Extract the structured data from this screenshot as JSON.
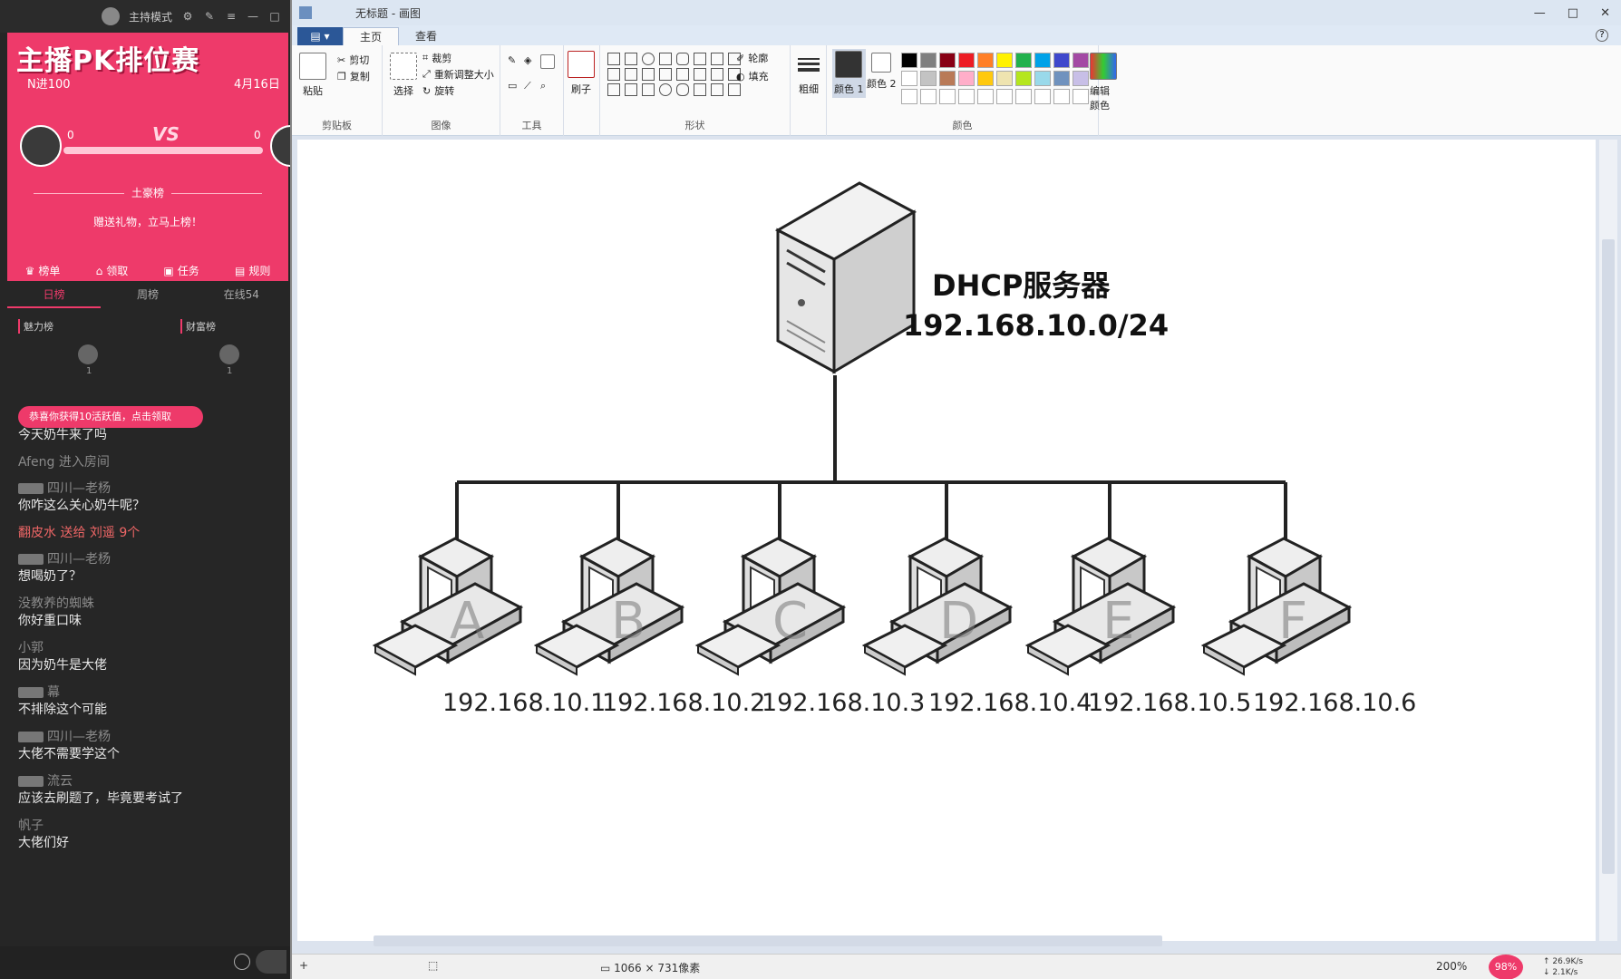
{
  "stream": {
    "mode": "主持模式",
    "pk_title": "主播PK排位赛",
    "pk_round": "N进100",
    "pk_date": "4月16日",
    "score_left": "0",
    "score_right": "0",
    "vs": "VS",
    "rich_label": "土豪榜",
    "gift_prompt": "赠送礼物，立马上榜！",
    "nav": [
      "榜单",
      "领取",
      "任务",
      "规则"
    ],
    "tabs": [
      "日榜",
      "周榜",
      "在线54"
    ],
    "sub_tabs": [
      "魅力榜",
      "财富榜"
    ],
    "rank_nums": [
      "1",
      "1"
    ],
    "claim": "恭喜你获得10活跃值，点击领取",
    "chat": [
      {
        "who": "",
        "text": "今天奶牛来了吗"
      },
      {
        "who": "Afeng 进入房间",
        "text": ""
      },
      {
        "who": "四川—老杨",
        "text": "你咋这么关心奶牛呢？",
        "badge": true
      },
      {
        "who": "翻皮水 送给 刘遥 9个",
        "text": "",
        "gift": true
      },
      {
        "who": "四川—老杨",
        "text": "想喝奶了？",
        "badge": true
      },
      {
        "who": "没教养的蜘蛛",
        "text": "你好重口味"
      },
      {
        "who": "小郭",
        "text": "因为奶牛是大佬"
      },
      {
        "who": "幕",
        "text": "不排除这个可能",
        "badge": true
      },
      {
        "who": "四川—老杨",
        "text": "大佬不需要学这个",
        "badge": true
      },
      {
        "who": "流云",
        "text": "应该去刷题了，毕竟要考试了",
        "badge": true
      },
      {
        "who": "帆子",
        "text": "大佬们好"
      }
    ]
  },
  "paint": {
    "title": "无标题 - 画图",
    "tabs": [
      "主页",
      "查看"
    ],
    "groups": {
      "clipboard": "剪贴板",
      "image": "图像",
      "tools": "工具",
      "shapes": "形状",
      "colors": "颜色"
    },
    "buttons": {
      "paste": "粘贴",
      "cut": "剪切",
      "copy": "复制",
      "select": "选择",
      "crop": "裁剪",
      "resize": "重新调整大小",
      "rotate": "旋转",
      "brush": "刷子",
      "outline": "轮廓",
      "fill": "填充",
      "size": "粗细",
      "color1": "颜色 1",
      "color2": "颜色 2",
      "edit_colors": "编辑颜色"
    },
    "palette": [
      "#000000",
      "#7f7f7f",
      "#880015",
      "#ed1c24",
      "#ff7f27",
      "#fff200",
      "#22b14c",
      "#00a2e8",
      "#3f48cc",
      "#a349a4",
      "#ffffff",
      "#c3c3c3",
      "#b97a57",
      "#ffaec9",
      "#ffc90e",
      "#efe4b0",
      "#b5e61d",
      "#99d9ea",
      "#7092be",
      "#c8bfe7",
      "#ffffff",
      "#ffffff",
      "#ffffff",
      "#ffffff",
      "#ffffff",
      "#ffffff",
      "#ffffff",
      "#ffffff",
      "#ffffff",
      "#ffffff"
    ],
    "status": {
      "dimensions": "1066 × 731像素",
      "zoom": "200%",
      "cpu": "98%",
      "up": "26.9K/s",
      "down": "2.1K/s"
    }
  },
  "diagram": {
    "server_label": "DHCP服务器",
    "server_subnet": "192.168.10.0/24",
    "client_letters": [
      "A",
      "B",
      "C",
      "D",
      "E",
      "F"
    ],
    "client_ips": [
      "192.168.10.1",
      "192.168.10.2",
      "192.168.10.3",
      "192.168.10.4",
      "192.168.10.5",
      "192.168.10.6"
    ]
  }
}
